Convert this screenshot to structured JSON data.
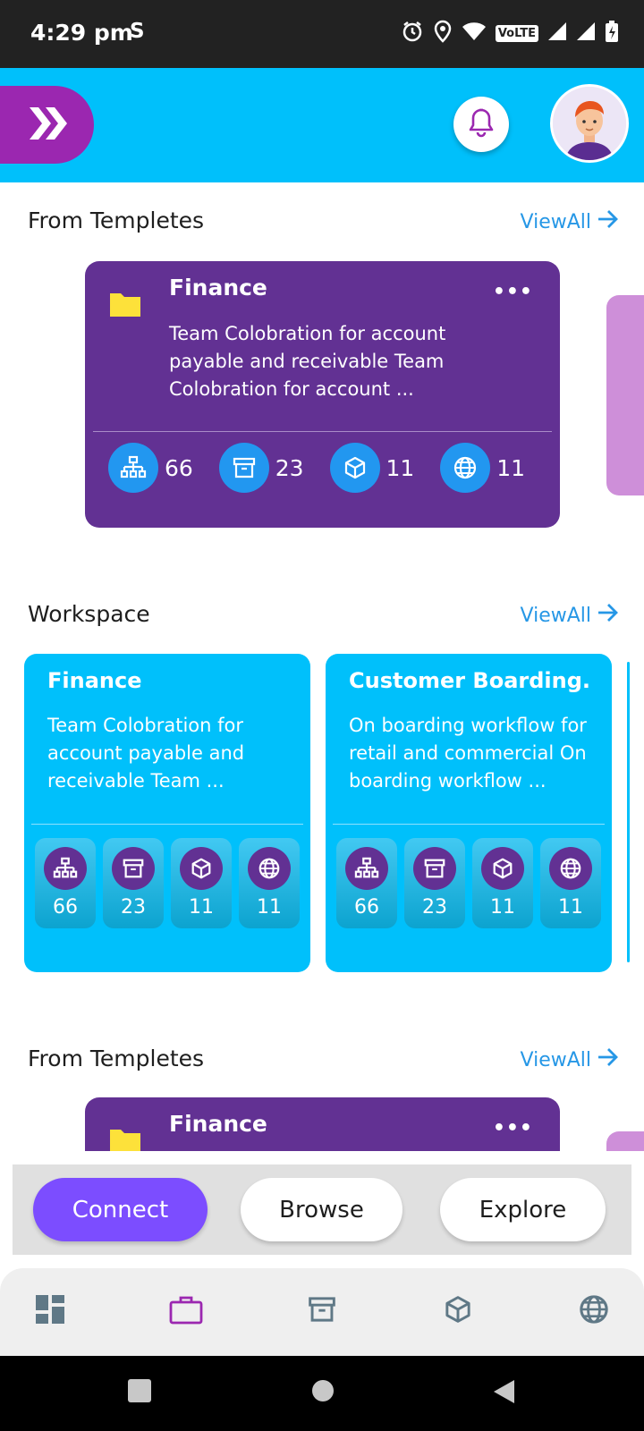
{
  "status_bar": {
    "time": "4:29 pm",
    "s_glyph": "S",
    "volte": "VoLTE",
    "icons": [
      "alarm-icon",
      "location-icon",
      "wifi-icon",
      "signal-icon",
      "signal-icon",
      "battery-charging-icon"
    ]
  },
  "header": {
    "logo": "double-chevron-icon",
    "notification": "bell-icon",
    "avatar": "user-avatar",
    "colors": {
      "bar": "#00c0fb",
      "logo": "#9b27b0"
    }
  },
  "sections": [
    {
      "title": "From Templetes",
      "view_all": "ViewAll",
      "card": {
        "title": "Finance",
        "description": "Team Colobration for account payable and receivable  Team Colobration for account ...",
        "menu": "•••",
        "stats": [
          {
            "icon": "sitemap-icon",
            "value": "66"
          },
          {
            "icon": "archive-icon",
            "value": "23"
          },
          {
            "icon": "cube-icon",
            "value": "11"
          },
          {
            "icon": "globe-icon",
            "value": "11"
          }
        ]
      }
    },
    {
      "title": "Workspace",
      "view_all": "ViewAll",
      "cards": [
        {
          "title": "Finance",
          "description": "Team Colobration for account payable and receivable  Team ...",
          "stats": [
            {
              "icon": "sitemap-icon",
              "value": "66"
            },
            {
              "icon": "archive-icon",
              "value": "23"
            },
            {
              "icon": "cube-icon",
              "value": "11"
            },
            {
              "icon": "globe-icon",
              "value": "11"
            }
          ]
        },
        {
          "title": "Customer Boarding.",
          "description": "On boarding workflow for retail and commercial On boarding workflow ...",
          "stats": [
            {
              "icon": "sitemap-icon",
              "value": "66"
            },
            {
              "icon": "archive-icon",
              "value": "23"
            },
            {
              "icon": "cube-icon",
              "value": "11"
            },
            {
              "icon": "globe-icon",
              "value": "11"
            }
          ]
        }
      ]
    },
    {
      "title": "From Templetes",
      "view_all": "ViewAll",
      "card": {
        "title": "Finance",
        "menu": "•••"
      }
    }
  ],
  "segments": {
    "items": [
      "Connect",
      "Browse",
      "Explore"
    ],
    "active": "Connect"
  },
  "bottom_nav": {
    "items": [
      "dashboard-icon",
      "briefcase-icon",
      "archive-icon",
      "cube-icon",
      "globe-icon"
    ],
    "active": "briefcase-icon"
  },
  "colors": {
    "template_card": "#623193",
    "workspace_card": "#00c0fb",
    "accent_link": "#2697e6",
    "segment_active": "#7c4dff"
  }
}
